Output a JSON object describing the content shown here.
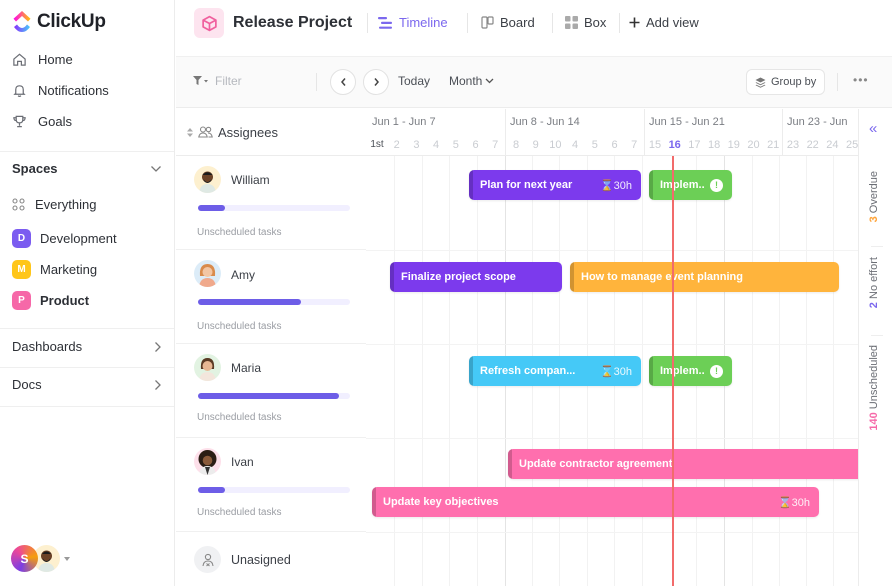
{
  "sidebar": {
    "brand": "ClickUp",
    "nav": [
      {
        "label": "Home",
        "icon": "home-icon"
      },
      {
        "label": "Notifications",
        "icon": "bell-icon"
      },
      {
        "label": "Goals",
        "icon": "trophy-icon"
      }
    ],
    "spaces_label": "Spaces",
    "everything_label": "Everything",
    "spaces": [
      {
        "letter": "D",
        "label": "Development",
        "color": "#7b5cf0"
      },
      {
        "letter": "M",
        "label": "Marketing",
        "color": "#ffc61a"
      },
      {
        "letter": "P",
        "label": "Product",
        "color": "#f668a8"
      }
    ],
    "dashboards_label": "Dashboards",
    "docs_label": "Docs",
    "user_initial": "S"
  },
  "header": {
    "project_title": "Release Project",
    "tabs": [
      {
        "label": "Timeline",
        "icon": "timeline-icon",
        "active": true
      },
      {
        "label": "Board",
        "icon": "board-icon",
        "active": false
      },
      {
        "label": "Box",
        "icon": "box-icon",
        "active": false
      }
    ],
    "add_view_label": "Add view"
  },
  "toolbar": {
    "filter_placeholder": "Filter",
    "today_label": "Today",
    "scale_label": "Month",
    "group_by_label": "Group by",
    "more_label": "•••"
  },
  "timeline": {
    "assignees_header": "Assignees",
    "weeks": [
      "Jun 1 - Jun 7",
      "Jun 8 - Jun 14",
      "Jun 15 - Jun 21",
      "Jun 23 - Jun"
    ],
    "days": [
      [
        "1st",
        "2",
        "3",
        "4",
        "5",
        "6",
        "7"
      ],
      [
        "8",
        "9",
        "10",
        "4",
        "5",
        "6",
        "7"
      ],
      [
        "15",
        "16",
        "17",
        "18",
        "19",
        "20",
        "21"
      ],
      [
        "23",
        "22",
        "24",
        "25"
      ]
    ],
    "today": "16",
    "assignees": [
      {
        "name": "William",
        "progress": 0.18,
        "unscheduled": "Unscheduled tasks"
      },
      {
        "name": "Amy",
        "progress": 0.68,
        "unscheduled": "Unscheduled tasks"
      },
      {
        "name": "Maria",
        "progress": 0.93,
        "unscheduled": "Unscheduled tasks"
      },
      {
        "name": "Ivan",
        "progress": 0.18,
        "unscheduled": "Unscheduled tasks"
      }
    ],
    "unassigned_label": "Unasigned",
    "tasks": [
      {
        "title": "Plan for next year",
        "duration": "30h",
        "color": "#7c3aed",
        "row": 0
      },
      {
        "title": "Implem..",
        "status": "warning",
        "color": "#6ccf56",
        "row": 0
      },
      {
        "title": "Finalize project scope",
        "color": "#7c3aed",
        "row": 1
      },
      {
        "title": "How to manage event planning",
        "color": "#ffb43c",
        "row": 1
      },
      {
        "title": "Refresh compan...",
        "duration": "30h",
        "color": "#45c9f7",
        "row": 2
      },
      {
        "title": "Implem..",
        "status": "warning",
        "color": "#6ccf56",
        "row": 2
      },
      {
        "title": "Update contractor agreement",
        "color": "#ff6fae",
        "row": 3
      },
      {
        "title": "Update key objectives",
        "duration": "30h",
        "color": "#ff6fae",
        "row": 3
      }
    ]
  },
  "right_panel": {
    "overdue_count": "3",
    "overdue_label": "Overdue",
    "no_effort_count": "2",
    "no_effort_label": "No effort",
    "unscheduled_count": "140",
    "unscheduled_label": "Unscheduled",
    "colors": {
      "overdue": "#ffa43a",
      "no_effort": "#7b68ee",
      "unscheduled": "#f668a8"
    }
  }
}
